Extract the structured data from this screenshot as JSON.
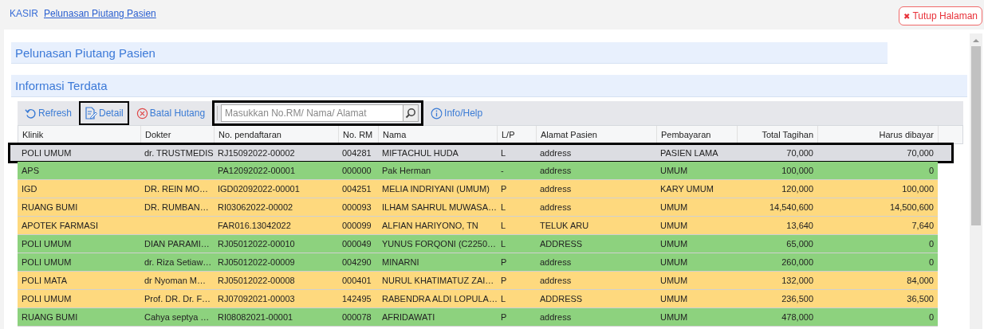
{
  "breadcrumb": {
    "root": "KASIR",
    "current": "Pelunasan Piutang Pasien"
  },
  "close_button": {
    "icon": "✖",
    "label": "Tutup Halaman"
  },
  "page_title": "Pelunasan Piutang Pasien",
  "section_title": "Informasi Terdata",
  "toolbar": [
    {
      "kind": "refresh",
      "label": "Refresh",
      "highlighted": false
    },
    {
      "kind": "detail",
      "label": "Detail",
      "highlighted": true
    },
    {
      "kind": "cancel",
      "label": "Batal Hutang",
      "highlighted": false
    },
    {
      "kind": "search",
      "placeholder": "Masukkan No.RM/ Nama/ Alamat",
      "highlighted": true
    },
    {
      "kind": "info",
      "label": "Info/Help",
      "highlighted": false
    }
  ],
  "table": {
    "columns": [
      "Klinik",
      "Dokter",
      "No. pendaftaran",
      "No. RM",
      "Nama",
      "L/P",
      "Alamat Pasien",
      "Pembayaran",
      "Total Tagihan",
      "Harus dibayar"
    ],
    "rows": [
      {
        "cells": [
          "POLI UMUM",
          "dr. TRUSTMEDIS",
          "RJ15092022-00002",
          "004281",
          "MIFTACHUL HUDA",
          "L",
          "address",
          "PASIEN LAMA",
          "70,000",
          "70,000"
        ],
        "selected": true,
        "highlighted": true
      },
      {
        "cells": [
          "APS",
          "",
          "PA12092022-00001",
          "000000",
          "Pak Herman",
          "-",
          "address",
          "UMUM",
          "100,000",
          "0"
        ],
        "color": "#8dd27e",
        "selected": false,
        "highlighted": false
      },
      {
        "cells": [
          "IGD",
          "DR. REIN MO…",
          "IGD02092022-00001",
          "004251",
          "MELIA INDRIYANI (UMUM)",
          "P",
          "address",
          "KARY UMUM",
          "120,000",
          "100,000"
        ],
        "color": "#fed97e",
        "selected": false,
        "highlighted": false
      },
      {
        "cells": [
          "RUANG BUMI",
          "DR. RUMBAN…",
          "RI03062022-00002",
          "000093",
          "ILHAM SAHRUL MUWASA…",
          "L",
          "address",
          "UMUM",
          "14,540,600",
          "14,500,600"
        ],
        "color": "#fed97e",
        "selected": false,
        "highlighted": false
      },
      {
        "cells": [
          "APOTEK FARMASI",
          "",
          "FAR016.13042022",
          "000099",
          "ALFIAN HARIYONO, TN",
          "L",
          "TELUK ARU",
          "UMUM",
          "13,640",
          "7,640"
        ],
        "color": "#fed97e",
        "selected": false,
        "highlighted": false
      },
      {
        "cells": [
          "POLI UMUM",
          "DIAN PARAMI…",
          "RJ05012022-00010",
          "000049",
          "YUNUS FORQONI (C2250…",
          "L",
          "ADDRESS",
          "UMUM",
          "65,000",
          "0"
        ],
        "color": "#8dd27e",
        "selected": false,
        "highlighted": false
      },
      {
        "cells": [
          "POLI UMUM",
          "dr. Riza Setiaw…",
          "RJ05012022-00009",
          "004290",
          "MINARNI",
          "P",
          "address",
          "UMUM",
          "260,000",
          "0"
        ],
        "color": "#8dd27e",
        "selected": false,
        "highlighted": false
      },
      {
        "cells": [
          "POLI MATA",
          "dr Nyoman M…",
          "RJ05012022-00008",
          "000401",
          "NURUL KHATIMATUZ ZAI…",
          "P",
          "address",
          "UMUM",
          "132,000",
          "84,000"
        ],
        "color": "#fed97e",
        "selected": false,
        "highlighted": false
      },
      {
        "cells": [
          "POLI UMUM",
          "Prof. DR. Dr. F…",
          "RJ07092021-00003",
          "142495",
          "RABENDRA ALDI LOPULA…",
          "L",
          "ADDRESS",
          "UMUM",
          "236,500",
          "36,500"
        ],
        "color": "#fed97e",
        "selected": false,
        "highlighted": false
      },
      {
        "cells": [
          "RUANG BUMI",
          "Cahya septya …",
          "RI08082021-00001",
          "000078",
          "AFRIDAWATI",
          "P",
          "address",
          "UMUM",
          "478,000",
          "0"
        ],
        "color": "#8dd27e",
        "selected": false,
        "highlighted": false
      }
    ]
  }
}
